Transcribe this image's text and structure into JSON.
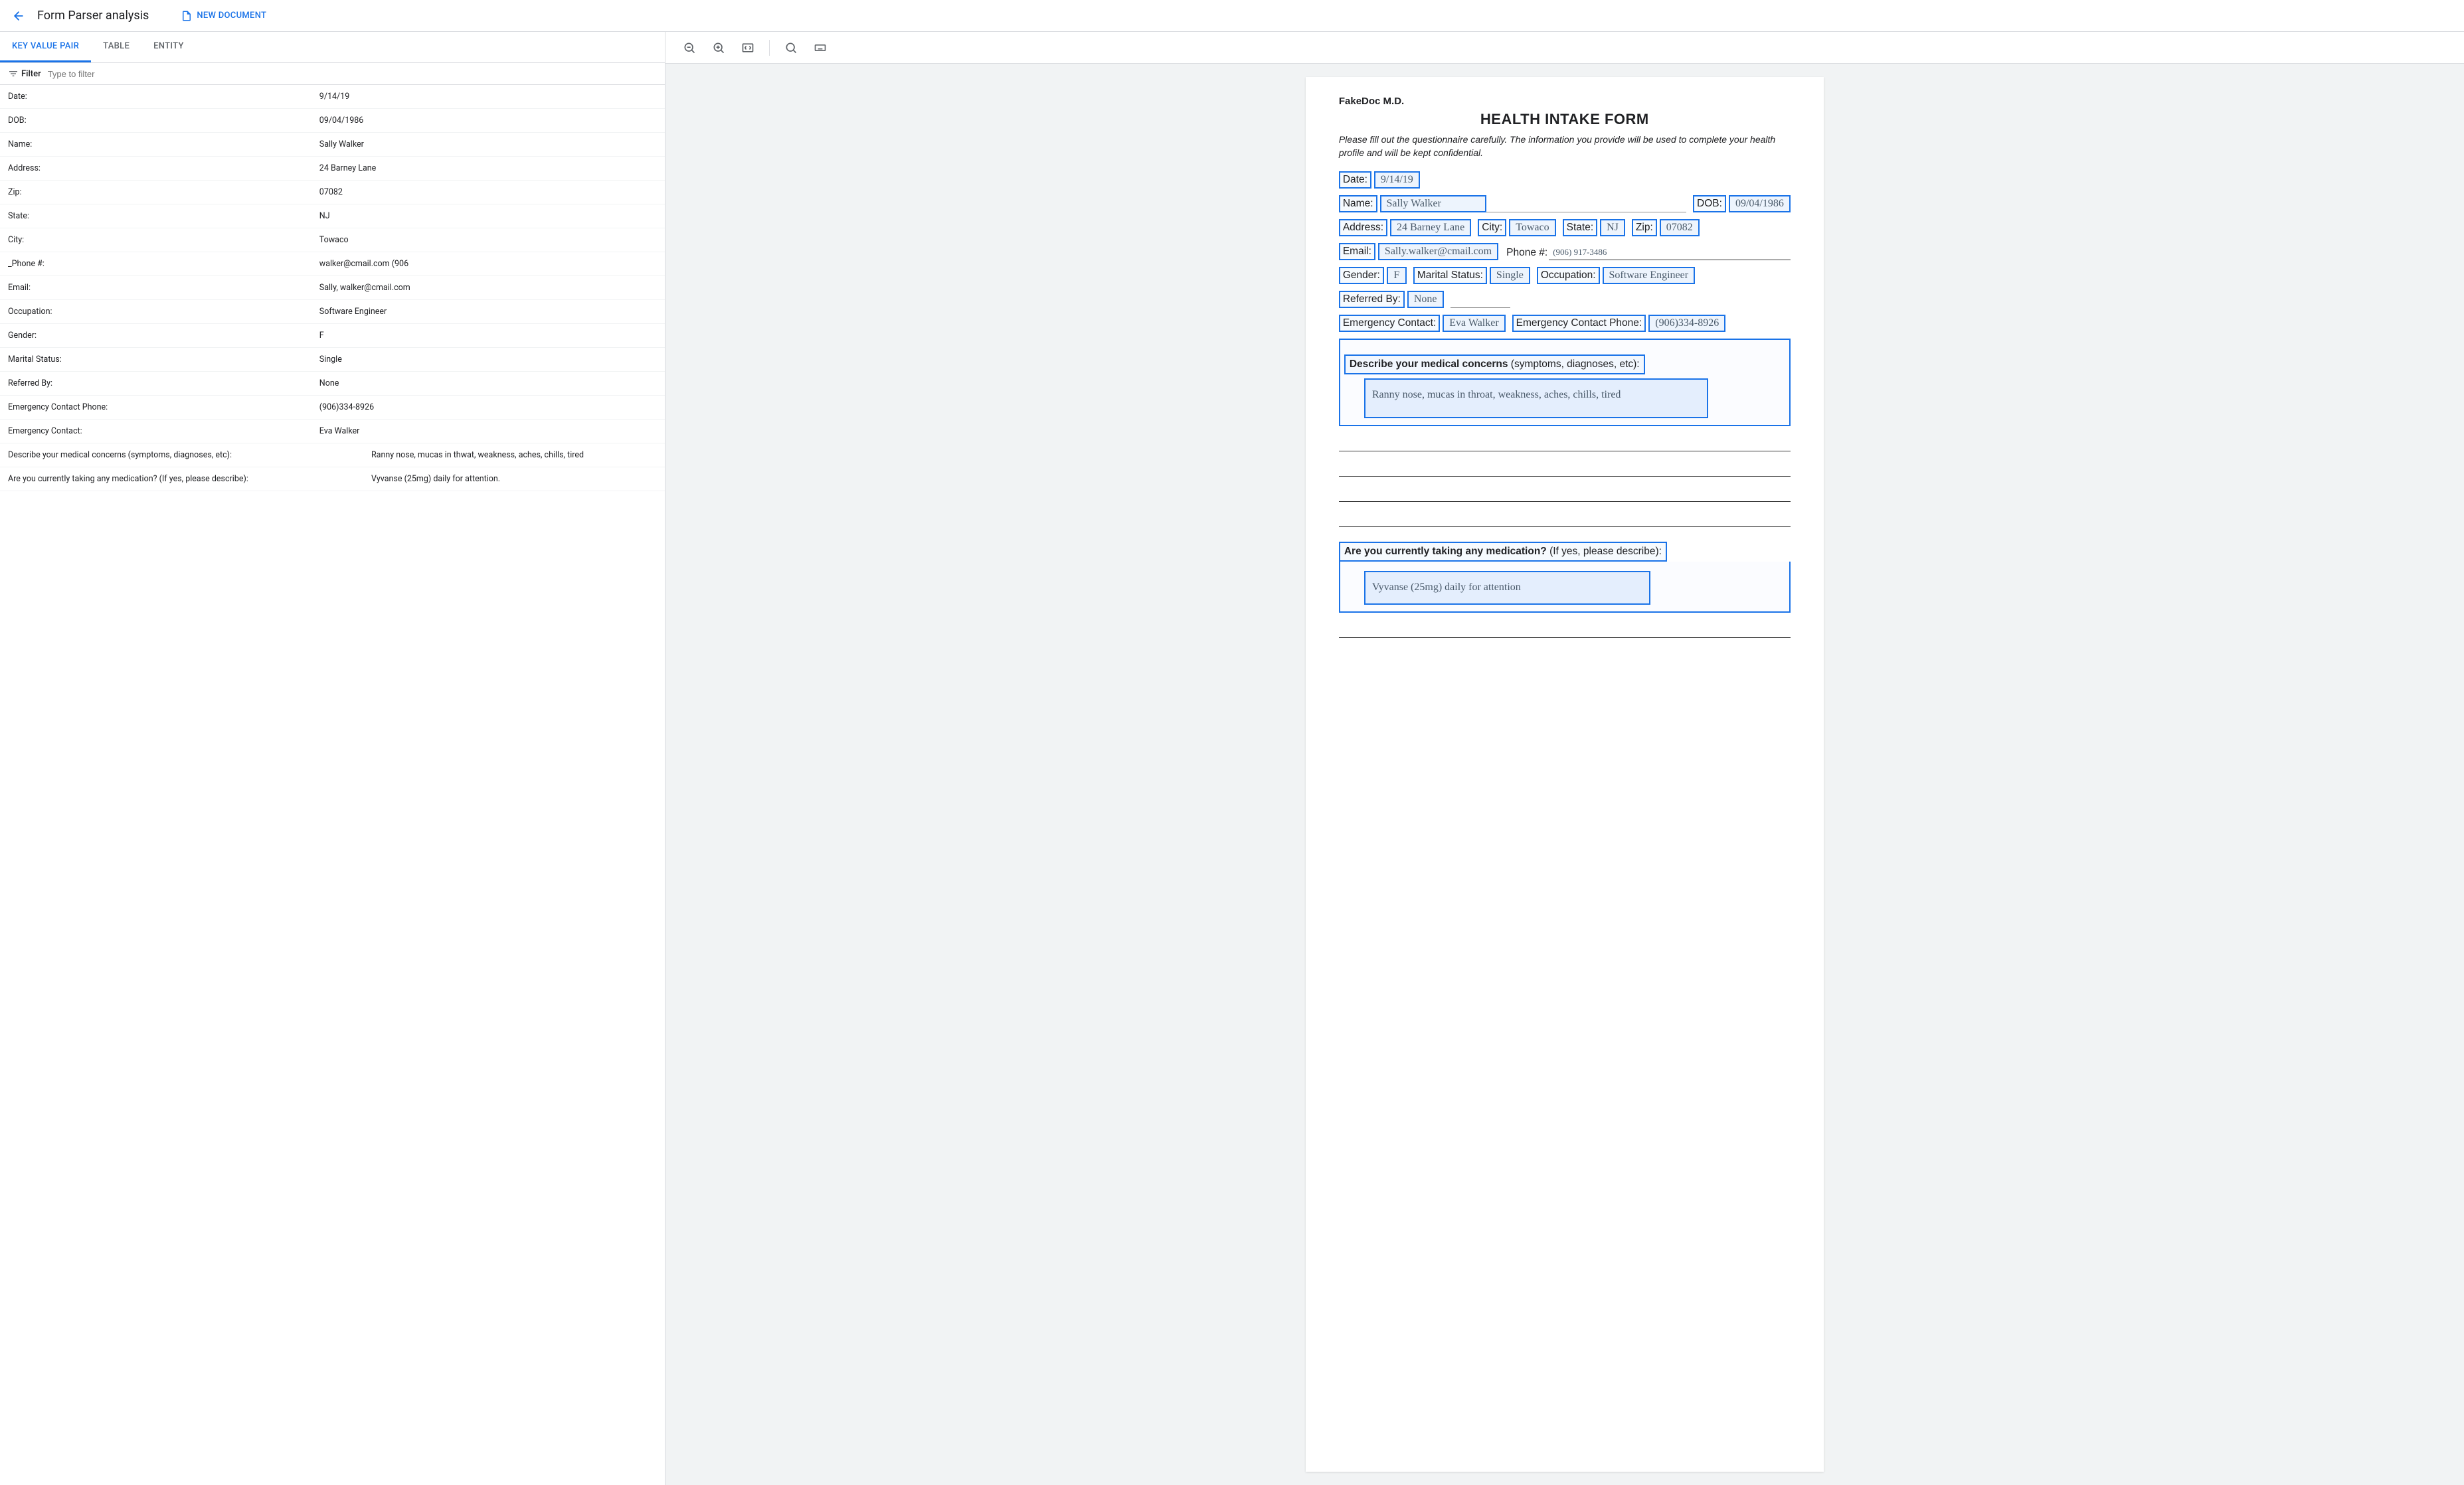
{
  "header": {
    "title": "Form Parser analysis",
    "new_document": "NEW DOCUMENT"
  },
  "tabs": {
    "kv": "KEY VALUE PAIR",
    "table": "TABLE",
    "entity": "ENTITY"
  },
  "filter": {
    "label": "Filter",
    "placeholder": "Type to filter"
  },
  "kv_pairs": [
    {
      "key": "Date:",
      "value": "9/14/19"
    },
    {
      "key": "DOB:",
      "value": "09/04/1986"
    },
    {
      "key": "Name:",
      "value": "Sally Walker"
    },
    {
      "key": "Address:",
      "value": "24 Barney Lane"
    },
    {
      "key": "Zip:",
      "value": "07082"
    },
    {
      "key": "State:",
      "value": "NJ"
    },
    {
      "key": "City:",
      "value": "Towaco"
    },
    {
      "key": "_Phone #:",
      "value": "walker@cmail.com (906"
    },
    {
      "key": "Email:",
      "value": "Sally, walker@cmail.com"
    },
    {
      "key": "Occupation:",
      "value": "Software Engineer"
    },
    {
      "key": "Gender:",
      "value": "F"
    },
    {
      "key": "Marital Status:",
      "value": "Single"
    },
    {
      "key": "Referred By:",
      "value": "None"
    },
    {
      "key": "Emergency Contact Phone:",
      "value": "(906)334-8926"
    },
    {
      "key": "Emergency Contact:",
      "value": "Eva Walker"
    },
    {
      "key": "Describe your medical concerns (symptoms, diagnoses, etc):",
      "value": "Ranny nose, mucas in thwat, weakness, aches, chills, tired"
    },
    {
      "key": "Are you currently taking any medication? (If yes, please describe):",
      "value": "Vyvanse (25mg) daily for attention."
    }
  ],
  "doc": {
    "header_name": "FakeDoc M.D.",
    "title": "HEALTH INTAKE FORM",
    "instructions": "Please fill out the questionnaire carefully. The information you provide will be used to complete your health profile and will be kept confidential.",
    "fields": {
      "date_label": "Date:",
      "date_value": "9/14/19",
      "name_label": "Name:",
      "name_value": "Sally Walker",
      "dob_label": "DOB:",
      "dob_value": "09/04/1986",
      "address_label": "Address:",
      "address_value": "24 Barney Lane",
      "city_label": "City:",
      "city_value": "Towaco",
      "state_label": "State:",
      "state_value": "NJ",
      "zip_label": "Zip:",
      "zip_value": "07082",
      "email_label": "Email:",
      "email_value": "Sally.walker@cmail.com",
      "phone_label": "Phone #:",
      "phone_value": "(906) 917-3486",
      "gender_label": "Gender:",
      "gender_value": "F",
      "marital_label": "Marital Status:",
      "marital_value": "Single",
      "occupation_label": "Occupation:",
      "occupation_value": "Software Engineer",
      "referred_label": "Referred By:",
      "referred_value": "None",
      "ec_label": "Emergency Contact:",
      "ec_value": "Eva Walker",
      "ecp_label": "Emergency Contact Phone:",
      "ecp_value": "(906)334-8926",
      "concerns_label_bold": "Describe your medical concerns",
      "concerns_label_rest": " (symptoms, diagnoses, etc):",
      "concerns_value": "Ranny nose, mucas in throat, weakness, aches, chills, tired",
      "meds_label_bold": "Are you currently taking any medication?",
      "meds_label_rest": " (If yes, please describe):",
      "meds_value": "Vyvanse (25mg) daily for attention"
    }
  }
}
